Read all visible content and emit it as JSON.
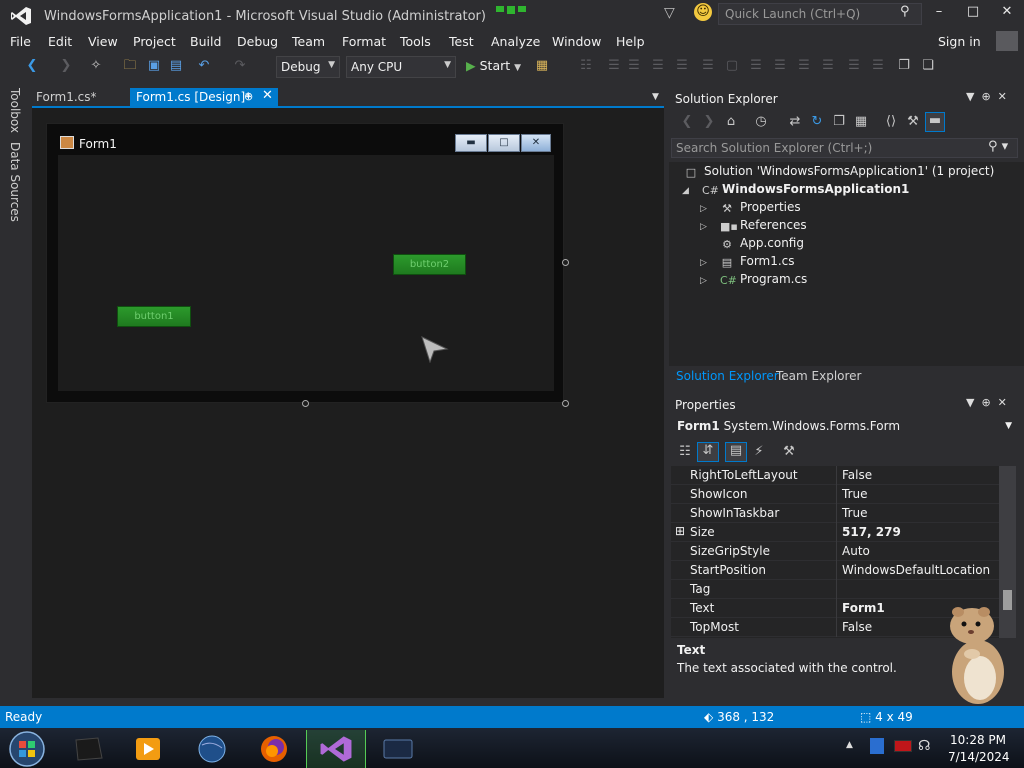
{
  "window": {
    "title": "WindowsFormsApplication1 - Microsoft Visual Studio (Administrator)",
    "quick_launch_placeholder": "Quick Launch (Ctrl+Q)",
    "min_label": "–",
    "max_label": "□",
    "close_label": "✕"
  },
  "menu": {
    "items": [
      "File",
      "Edit",
      "View",
      "Project",
      "Build",
      "Debug",
      "Team",
      "Format",
      "Tools",
      "Test",
      "Analyze",
      "Window",
      "Help"
    ],
    "sign_in": "Sign in"
  },
  "toolbar": {
    "config": "Debug",
    "platform": "Any CPU",
    "start": "Start"
  },
  "side_tabs": [
    "Toolbox",
    "Data Sources"
  ],
  "doc_tabs": [
    {
      "label": "Form1.cs*"
    },
    {
      "label": "Form1.cs [Design]*"
    }
  ],
  "designer": {
    "form_title": "Form1",
    "button1": "button1",
    "button2": "button2"
  },
  "solution_explorer": {
    "title": "Solution Explorer",
    "search_placeholder": "Search Solution Explorer (Ctrl+;)",
    "tree": [
      {
        "label": "Solution 'WindowsFormsApplication1' (1 project)",
        "bold": false
      },
      {
        "label": "WindowsFormsApplication1",
        "bold": true
      },
      {
        "label": "Properties",
        "bold": false
      },
      {
        "label": "References",
        "bold": false
      },
      {
        "label": "App.config",
        "bold": false
      },
      {
        "label": "Form1.cs",
        "bold": false
      },
      {
        "label": "Program.cs",
        "bold": false
      }
    ],
    "tabs": [
      "Solution Explorer",
      "Team Explorer"
    ]
  },
  "properties": {
    "title": "Properties",
    "object_name": "Form1",
    "object_type": "System.Windows.Forms.Form",
    "rows": [
      {
        "name": "RightToLeftLayout",
        "value": "False"
      },
      {
        "name": "ShowIcon",
        "value": "True"
      },
      {
        "name": "ShowInTaskbar",
        "value": "True"
      },
      {
        "name": "Size",
        "value": "517, 279"
      },
      {
        "name": "SizeGripStyle",
        "value": "Auto"
      },
      {
        "name": "StartPosition",
        "value": "WindowsDefaultLocation"
      },
      {
        "name": "Tag",
        "value": ""
      },
      {
        "name": "Text",
        "value": "Form1"
      },
      {
        "name": "TopMost",
        "value": "False"
      }
    ],
    "desc_title": "Text",
    "desc_text": "The text associated with the control."
  },
  "status": {
    "text": "Ready",
    "position": "368 , 132",
    "size": "4 x 49"
  },
  "taskbar": {
    "time": "10:28 PM",
    "date": "7/14/2024"
  }
}
